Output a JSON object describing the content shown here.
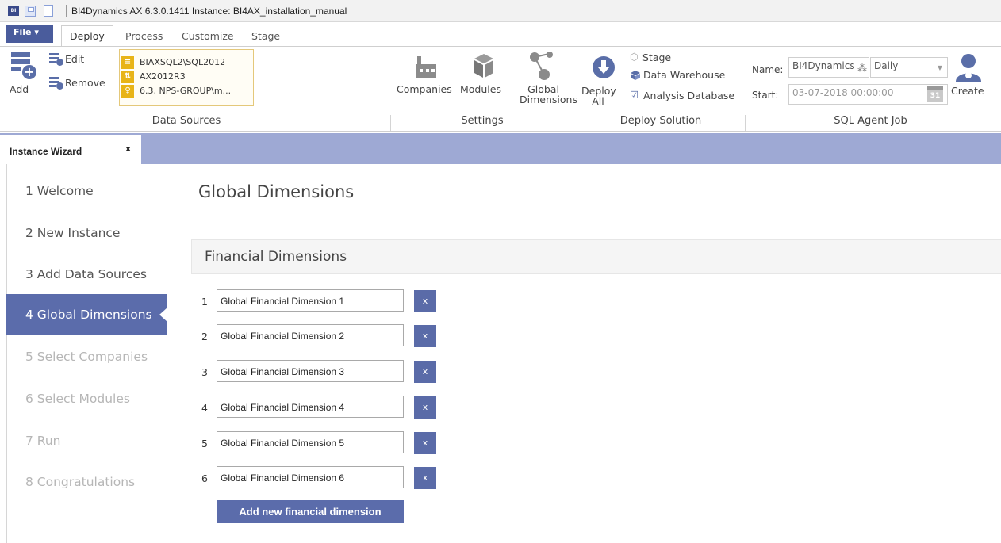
{
  "window": {
    "title": "BI4Dynamics AX 6.3.0.1411  Instance: BI4AX_installation_manual"
  },
  "ribbon_tabs": {
    "file": "File",
    "tabs": [
      "Deploy",
      "Process",
      "Customize",
      "Stage"
    ],
    "active": "Deploy"
  },
  "ribbon": {
    "data_sources": {
      "add": "Add",
      "edit": "Edit",
      "remove": "Remove",
      "sources": [
        "BIAXSQL2\\SQL2012",
        "AX2012R3",
        "6.3, NPS-GROUP\\m..."
      ],
      "group_label": "Data Sources"
    },
    "settings": {
      "companies": "Companies",
      "modules": "Modules",
      "global_line1": "Global",
      "global_line2": "Dimensions",
      "group_label": "Settings"
    },
    "deploy": {
      "deploy_line1": "Deploy",
      "deploy_line2": "All",
      "stage": "Stage",
      "data_warehouse": "Data Warehouse",
      "analysis_database": "Analysis Database",
      "group_label": "Deploy Solution"
    },
    "sql_job": {
      "name_label": "Name:",
      "name_value": "BI4Dynamics",
      "schedule_value": "Daily",
      "start_label": "Start:",
      "start_value": "03-07-2018 00:00:00",
      "calendar_day": "31",
      "create": "Create",
      "group_label": "SQL Agent Job"
    }
  },
  "doc_tab": {
    "label": "Instance Wizard",
    "close": "x"
  },
  "wizard_steps": [
    {
      "label": "1  Welcome",
      "state": "done"
    },
    {
      "label": "2  New Instance",
      "state": "done"
    },
    {
      "label": "3  Add Data Sources",
      "state": "done"
    },
    {
      "label": "4  Global Dimensions",
      "state": "active"
    },
    {
      "label": "5  Select Companies",
      "state": "disabled"
    },
    {
      "label": "6  Select Modules",
      "state": "disabled"
    },
    {
      "label": "7  Run",
      "state": "disabled"
    },
    {
      "label": "8  Congratulations",
      "state": "disabled"
    }
  ],
  "main": {
    "page_title": "Global Dimensions",
    "section_title": "Financial Dimensions",
    "remove_label": "x",
    "dimensions": [
      {
        "num": "1",
        "value": "Global Financial Dimension 1"
      },
      {
        "num": "2",
        "value": "Global Financial Dimension 2"
      },
      {
        "num": "3",
        "value": "Global Financial Dimension 3"
      },
      {
        "num": "4",
        "value": "Global Financial Dimension 4"
      },
      {
        "num": "5",
        "value": "Global Financial Dimension 5"
      },
      {
        "num": "6",
        "value": "Global Financial Dimension 6"
      }
    ],
    "add_button": "Add new financial dimension"
  },
  "colors": {
    "accent": "#5b6cab",
    "doc_bar": "#9ea9d4",
    "data_source_icon": "#e8b418"
  }
}
